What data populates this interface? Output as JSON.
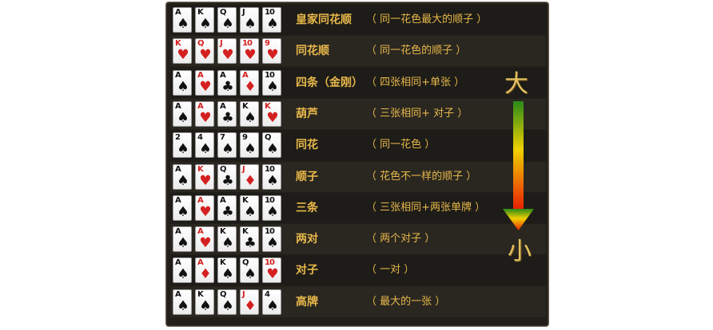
{
  "colors": {
    "red_suit": "#d42020",
    "black_suit": "#111111",
    "accent_text": "#e8b84a",
    "arrow_top": "#2a8a1a",
    "arrow_mid": "#f0d000",
    "arrow_bottom": "#e82000"
  },
  "scale": {
    "high_label": "大",
    "low_label": "小",
    "arrow_icon": "gradient-down-arrow"
  },
  "hands": [
    {
      "name": "皇家同花顺",
      "desc": "（ 同一花色最大的顺子 ）",
      "cards": [
        {
          "rank": "A",
          "suit": "♠"
        },
        {
          "rank": "K",
          "suit": "♠"
        },
        {
          "rank": "Q",
          "suit": "♠"
        },
        {
          "rank": "J",
          "suit": "♠"
        },
        {
          "rank": "10",
          "suit": "♠"
        }
      ]
    },
    {
      "name": "同花顺",
      "desc": "（ 同一花色的顺子 ）",
      "cards": [
        {
          "rank": "K",
          "suit": "♥"
        },
        {
          "rank": "Q",
          "suit": "♥"
        },
        {
          "rank": "J",
          "suit": "♥"
        },
        {
          "rank": "10",
          "suit": "♥"
        },
        {
          "rank": "9",
          "suit": "♥"
        }
      ]
    },
    {
      "name": "四条（金刚）",
      "desc": "（ 四张相同+单张 ）",
      "cards": [
        {
          "rank": "A",
          "suit": "♠"
        },
        {
          "rank": "A",
          "suit": "♥"
        },
        {
          "rank": "A",
          "suit": "♣"
        },
        {
          "rank": "A",
          "suit": "♦"
        },
        {
          "rank": "10",
          "suit": "♠"
        }
      ]
    },
    {
      "name": "葫芦",
      "desc": "（ 三张相同+ 对子 ）",
      "cards": [
        {
          "rank": "A",
          "suit": "♠"
        },
        {
          "rank": "A",
          "suit": "♥"
        },
        {
          "rank": "A",
          "suit": "♣"
        },
        {
          "rank": "K",
          "suit": "♠"
        },
        {
          "rank": "K",
          "suit": "♥"
        }
      ]
    },
    {
      "name": "同花",
      "desc": "（ 同一花色 ）",
      "cards": [
        {
          "rank": "2",
          "suit": "♠"
        },
        {
          "rank": "4",
          "suit": "♠"
        },
        {
          "rank": "7",
          "suit": "♠"
        },
        {
          "rank": "9",
          "suit": "♠"
        },
        {
          "rank": "Q",
          "suit": "♠"
        }
      ]
    },
    {
      "name": "顺子",
      "desc": "（ 花色不一样的顺子 ）",
      "cards": [
        {
          "rank": "A",
          "suit": "♠"
        },
        {
          "rank": "K",
          "suit": "♥"
        },
        {
          "rank": "Q",
          "suit": "♣"
        },
        {
          "rank": "J",
          "suit": "♦"
        },
        {
          "rank": "10",
          "suit": "♠"
        }
      ]
    },
    {
      "name": "三条",
      "desc": "（ 三张相同+两张单牌 ）",
      "cards": [
        {
          "rank": "A",
          "suit": "♠"
        },
        {
          "rank": "A",
          "suit": "♥"
        },
        {
          "rank": "A",
          "suit": "♣"
        },
        {
          "rank": "K",
          "suit": "♠"
        },
        {
          "rank": "10",
          "suit": "♠"
        }
      ]
    },
    {
      "name": "两对",
      "desc": "（ 两个对子 ）",
      "cards": [
        {
          "rank": "A",
          "suit": "♠"
        },
        {
          "rank": "A",
          "suit": "♥"
        },
        {
          "rank": "K",
          "suit": "♠"
        },
        {
          "rank": "K",
          "suit": "♣"
        },
        {
          "rank": "10",
          "suit": "♠"
        }
      ]
    },
    {
      "name": "对子",
      "desc": "（ 一对 ）",
      "cards": [
        {
          "rank": "A",
          "suit": "♠"
        },
        {
          "rank": "A",
          "suit": "♦"
        },
        {
          "rank": "K",
          "suit": "♠"
        },
        {
          "rank": "Q",
          "suit": "♠"
        },
        {
          "rank": "10",
          "suit": "♥"
        }
      ]
    },
    {
      "name": "高牌",
      "desc": "（ 最大的一张 ）",
      "cards": [
        {
          "rank": "A",
          "suit": "♠"
        },
        {
          "rank": "K",
          "suit": "♠"
        },
        {
          "rank": "Q",
          "suit": "♠"
        },
        {
          "rank": "J",
          "suit": "♦"
        },
        {
          "rank": "4",
          "suit": "♠"
        }
      ]
    }
  ]
}
